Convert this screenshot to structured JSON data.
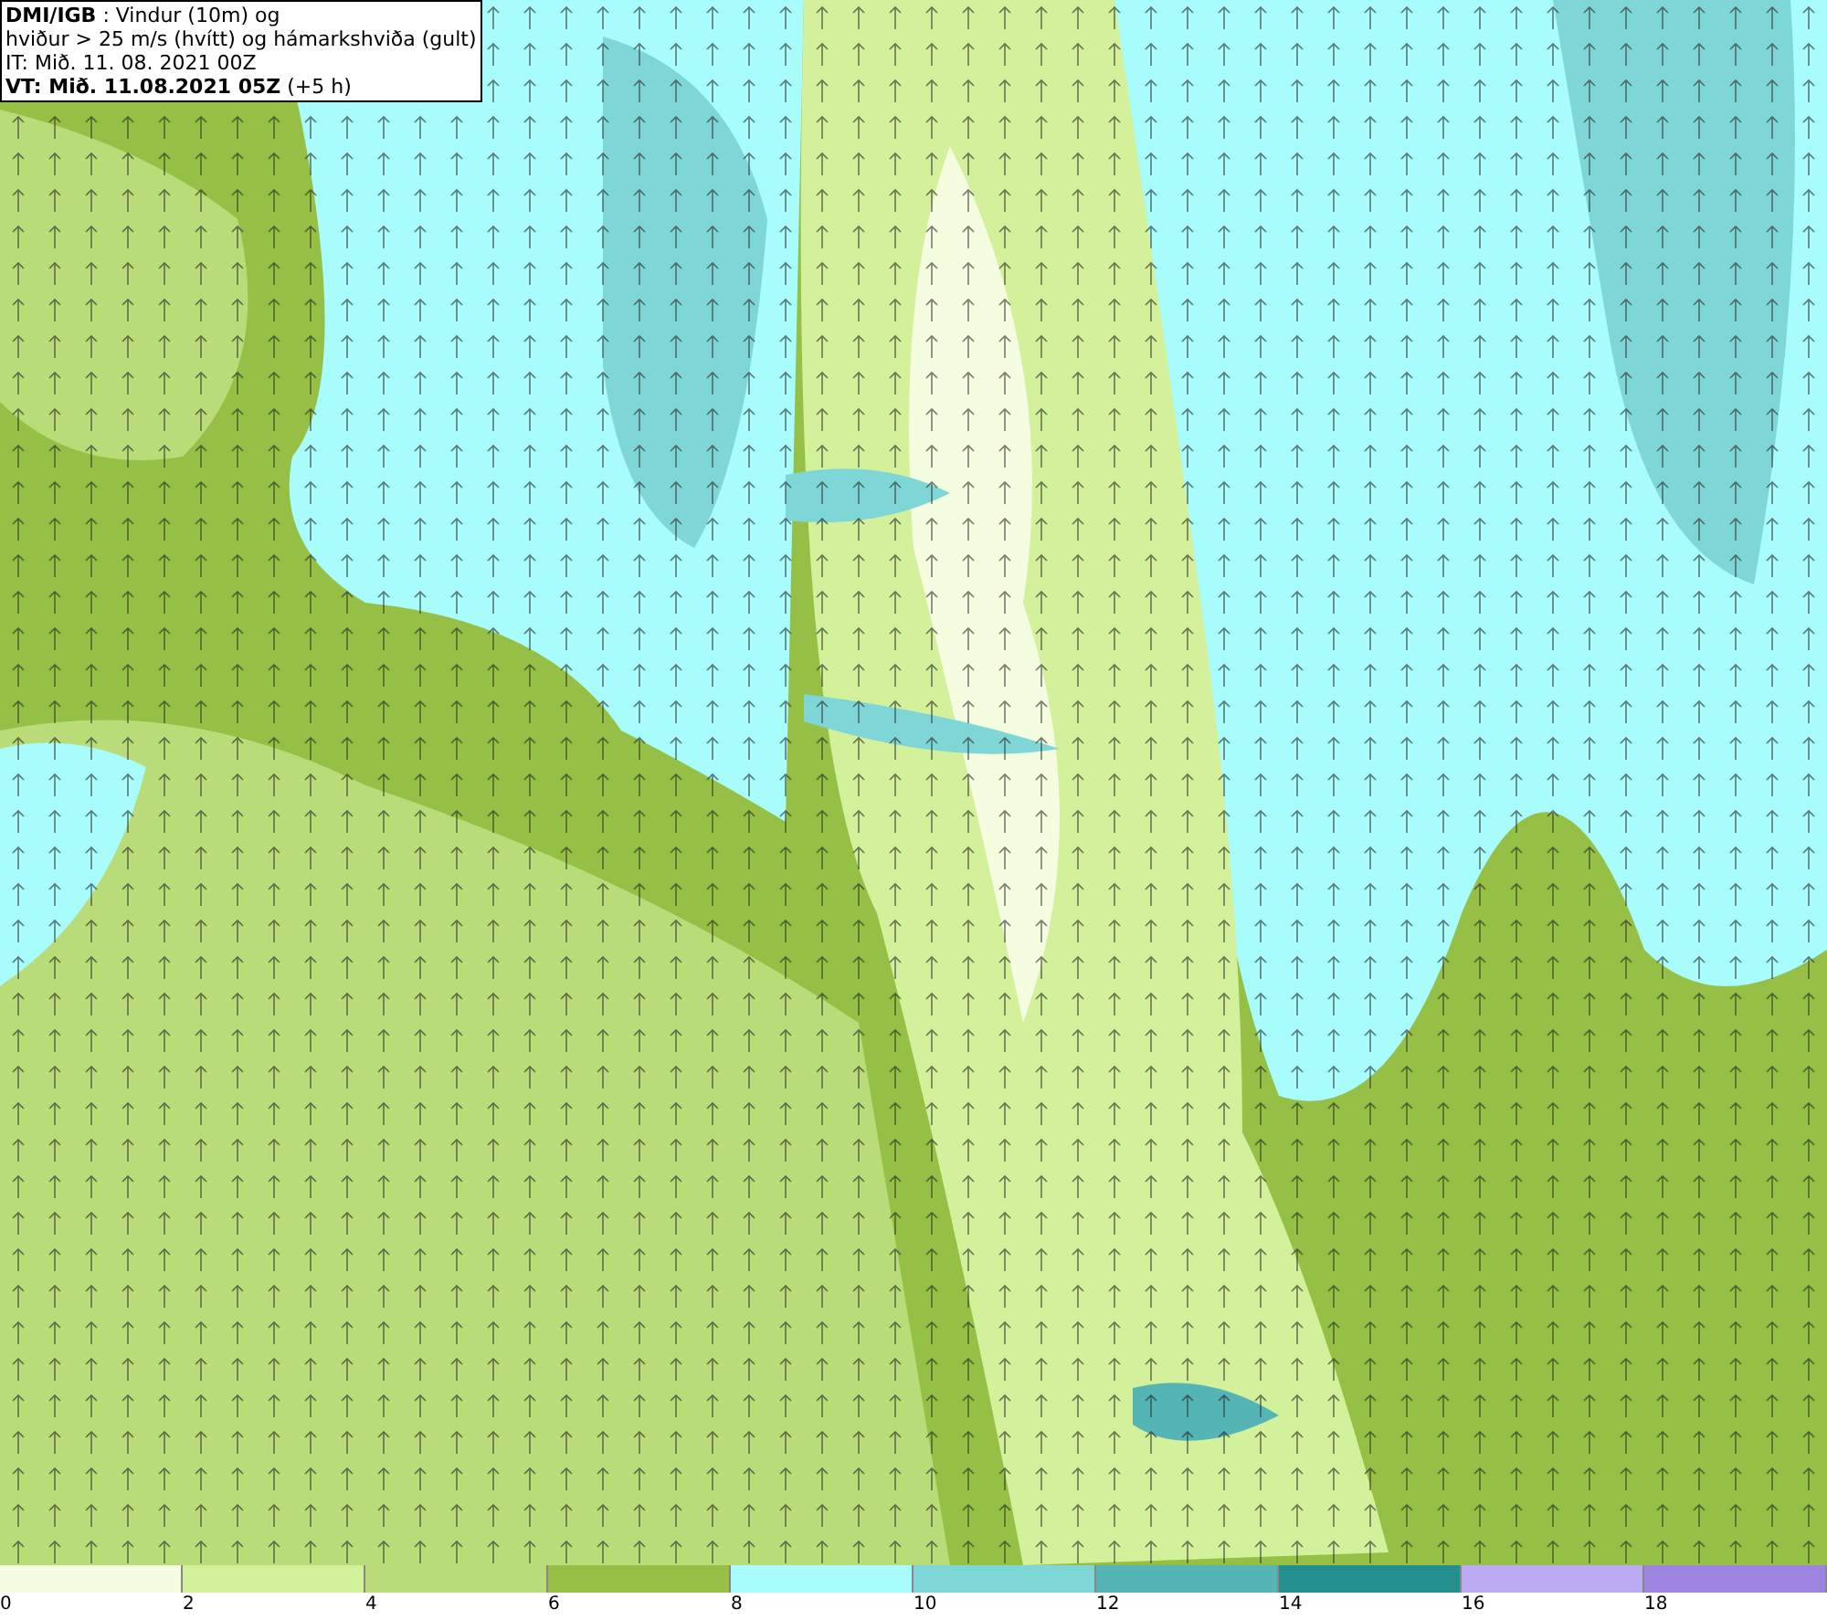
{
  "info_box": {
    "lines": [
      "**DMI/IGB** : Vindur (10m) og",
      "hviður > 25 m/s (hvítt) og hámarkshviða (gult)",
      "IT: Mið. 11. 08. 2021 00Z",
      "**VT: Mið. 11.08.2021 05Z** (+5 h)"
    ]
  },
  "legend": [
    {
      "label": "0",
      "color": "#f5fde0"
    },
    {
      "label": "2",
      "color": "#d3f09a"
    },
    {
      "label": "4",
      "color": "#b9dc78"
    },
    {
      "label": "6",
      "color": "#96bf45"
    },
    {
      "label": "8",
      "color": "#a8fcfc"
    },
    {
      "label": "10",
      "color": "#7fd6d6"
    },
    {
      "label": "12",
      "color": "#55b4b4"
    },
    {
      "label": "14",
      "color": "#238f8f"
    },
    {
      "label": "16",
      "color": "#bcaaf2"
    },
    {
      "label": "18",
      "color": "#9c84e0"
    }
  ]
}
